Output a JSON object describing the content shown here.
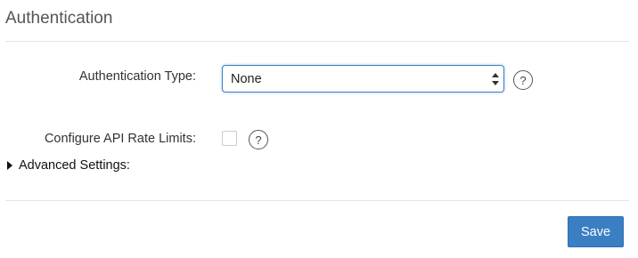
{
  "section": {
    "title": "Authentication"
  },
  "form": {
    "auth_type": {
      "label": "Authentication Type:",
      "selected_value": "None",
      "help_symbol": "?"
    },
    "rate_limits": {
      "label": "Configure API Rate Limits:",
      "checked": false,
      "help_symbol": "?"
    },
    "advanced": {
      "label": "Advanced Settings:",
      "expanded": false
    }
  },
  "actions": {
    "save_label": "Save"
  },
  "icons": {
    "select_arrows": "up-down-arrows-icon",
    "help": "question-circle-icon",
    "expand": "caret-right-icon"
  },
  "colors": {
    "primary": "#3a7fc3",
    "focus_border": "#3e80c2"
  }
}
